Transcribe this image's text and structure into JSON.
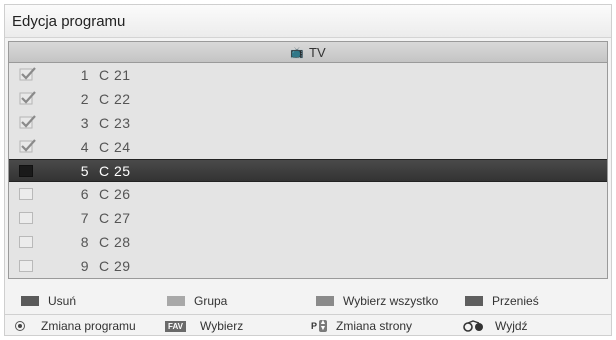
{
  "title": "Edycja programu",
  "list": {
    "header": "TV",
    "header_icon": "tv-icon",
    "channels": [
      {
        "num": "1",
        "name": "C 21",
        "checked": true,
        "selected": false
      },
      {
        "num": "2",
        "name": "C 22",
        "checked": true,
        "selected": false
      },
      {
        "num": "3",
        "name": "C 23",
        "checked": true,
        "selected": false
      },
      {
        "num": "4",
        "name": "C 24",
        "checked": true,
        "selected": false
      },
      {
        "num": "5",
        "name": "C 25",
        "checked": false,
        "selected": true
      },
      {
        "num": "6",
        "name": "C 26",
        "checked": false,
        "selected": false
      },
      {
        "num": "7",
        "name": "C 27",
        "checked": false,
        "selected": false
      },
      {
        "num": "8",
        "name": "C 28",
        "checked": false,
        "selected": false
      },
      {
        "num": "9",
        "name": "C 29",
        "checked": false,
        "selected": false
      }
    ]
  },
  "color_keys": [
    {
      "label": "Usuń",
      "color": "#5a5a5a"
    },
    {
      "label": "Grupa",
      "color": "#a8a8a8"
    },
    {
      "label": "Wybierz wszystko",
      "color": "#8a8a8a"
    },
    {
      "label": "Przenieś",
      "color": "#5e5e5e"
    }
  ],
  "footer": {
    "change_program": "Zmiana programu",
    "fav_badge": "FAV",
    "select": "Wybierz",
    "p_badge": "P",
    "change_page": "Zmiana strony",
    "exit": "Wyjdź"
  }
}
